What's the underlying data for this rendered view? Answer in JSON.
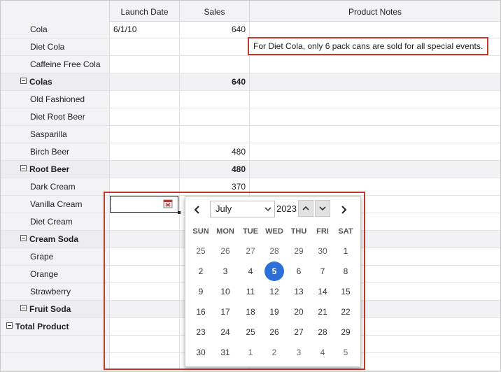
{
  "columns": {
    "launch_date": "Launch Date",
    "sales": "Sales",
    "notes": "Product Notes"
  },
  "rows": [
    {
      "label": "Cola",
      "date": "6/1/10",
      "sales": "640",
      "notes": ""
    },
    {
      "label": "Diet Cola",
      "date": "",
      "sales": "",
      "notes": "For Diet Cola, only 6 pack cans are sold for all special events."
    },
    {
      "label": "Caffeine Free Cola",
      "date": "",
      "sales": "",
      "notes": ""
    },
    {
      "label": "Colas",
      "date": "",
      "sales": "640",
      "notes": ""
    },
    {
      "label": "Old Fashioned",
      "date": "",
      "sales": "",
      "notes": ""
    },
    {
      "label": "Diet Root Beer",
      "date": "",
      "sales": "",
      "notes": ""
    },
    {
      "label": "Sasparilla",
      "date": "",
      "sales": "",
      "notes": ""
    },
    {
      "label": "Birch Beer",
      "date": "",
      "sales": "480",
      "notes": ""
    },
    {
      "label": "Root Beer",
      "date": "",
      "sales": "480",
      "notes": ""
    },
    {
      "label": "Dark Cream",
      "date": "",
      "sales": "370",
      "notes": ""
    },
    {
      "label": "Vanilla Cream",
      "date": "",
      "sales": "",
      "notes": ""
    },
    {
      "label": "Diet Cream",
      "date": "",
      "sales": "",
      "notes": ""
    },
    {
      "label": "Cream Soda",
      "date": "",
      "sales": "",
      "notes": ""
    },
    {
      "label": "Grape",
      "date": "",
      "sales": "",
      "notes": ""
    },
    {
      "label": "Orange",
      "date": "",
      "sales": "",
      "notes": ""
    },
    {
      "label": "Strawberry",
      "date": "",
      "sales": "",
      "notes": ""
    },
    {
      "label": "Fruit Soda",
      "date": "",
      "sales": "",
      "notes": ""
    },
    {
      "label": "Total Product",
      "date": "",
      "sales": "",
      "notes": ""
    },
    {
      "label": "",
      "date": "",
      "sales": "",
      "notes": ""
    },
    {
      "label": "",
      "date": "",
      "sales": "",
      "notes": ""
    }
  ],
  "calendar": {
    "month": "July",
    "year": "2023",
    "weekdays": [
      "SUN",
      "MON",
      "TUE",
      "WED",
      "THU",
      "FRI",
      "SAT"
    ],
    "weeks": [
      [
        "25",
        "26",
        "27",
        "28",
        "29",
        "30",
        "1"
      ],
      [
        "2",
        "3",
        "4",
        "5",
        "6",
        "7",
        "8"
      ],
      [
        "9",
        "10",
        "11",
        "12",
        "13",
        "14",
        "15"
      ],
      [
        "16",
        "17",
        "18",
        "19",
        "20",
        "21",
        "22"
      ],
      [
        "23",
        "24",
        "25",
        "26",
        "27",
        "28",
        "29"
      ],
      [
        "30",
        "31",
        "1",
        "2",
        "3",
        "4",
        "5"
      ]
    ],
    "selected": "5"
  },
  "icons": {
    "prev": "chevron-left-icon",
    "next": "chevron-right-icon",
    "calendar": "calendar-icon"
  },
  "colors": {
    "highlight_border": "#c0392b",
    "selected_day": "#2d6fd8",
    "header_bg": "#f3f3f6"
  }
}
